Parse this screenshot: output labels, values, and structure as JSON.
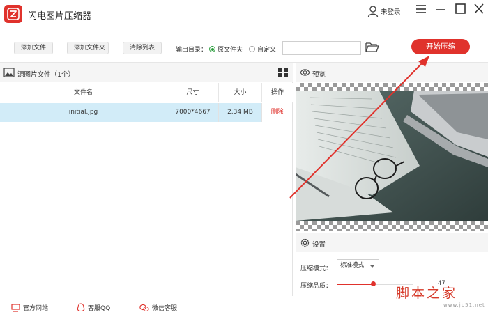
{
  "app": {
    "title": "闪电图片压缩器",
    "user_label": "未登录"
  },
  "toolbar": {
    "add_file": "添加文件",
    "add_folder": "添加文件夹",
    "clear_list": "清除列表",
    "output_label": "输出目录：",
    "option_original": "原文件夹",
    "option_custom": "自定义",
    "path_value": "",
    "start_label": "开始压缩"
  },
  "file_panel": {
    "title": "源图片文件（1个）",
    "columns": [
      "文件名",
      "尺寸",
      "大小",
      "操作"
    ],
    "rows": [
      {
        "name": "initial.jpg",
        "dimensions": "7000*4667",
        "size": "2.34 MB",
        "action": "删除"
      }
    ]
  },
  "preview": {
    "title": "预览"
  },
  "settings": {
    "title": "设置",
    "mode_label": "压缩模式：",
    "mode_value": "标准模式",
    "quality_label": "压缩品质：",
    "quality_value": "47"
  },
  "bottom": {
    "website": "官方网站",
    "qq": "客服QQ",
    "wechat": "微信客服"
  },
  "watermark": {
    "main": "脚本之家",
    "url": "www.jb51.net"
  },
  "colors": {
    "accent": "#e0322c",
    "selected_row": "#d2ecf8",
    "radio_checked": "#2a9d3c"
  }
}
